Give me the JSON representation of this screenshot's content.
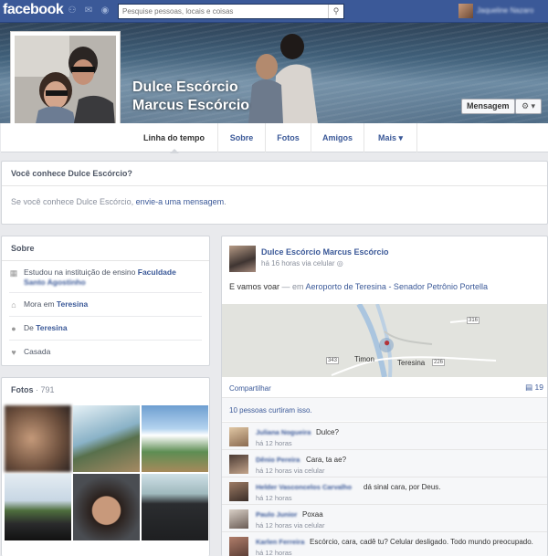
{
  "topbar": {
    "logo": "facebook",
    "search_placeholder": "Pesquise pessoas, locais e coisas",
    "user_name": "Jaqueline Nazaro"
  },
  "profile": {
    "name_line1": "Dulce Escórcio",
    "name_line2": "Marcus Escórcio",
    "message_button": "Mensagem"
  },
  "tabs": [
    {
      "label": "Linha do tempo"
    },
    {
      "label": "Sobre"
    },
    {
      "label": "Fotos"
    },
    {
      "label": "Amigos"
    },
    {
      "label": "Mais"
    }
  ],
  "know_card": {
    "title": "Você conhece Dulce Escórcio?",
    "body_prefix": "Se você conhece Dulce Escórcio, ",
    "body_link": "envie-a uma mensagem",
    "body_suffix": "."
  },
  "about": {
    "title": "Sobre",
    "education_prefix": "Estudou na instituição de ensino ",
    "education_school": "Faculdade",
    "education_school_2": "Santo Agostinho",
    "lives_prefix": "Mora em ",
    "lives_city": "Teresina",
    "from_prefix": "De ",
    "from_city": "Teresina",
    "relationship": "Casada"
  },
  "photos": {
    "title": "Fotos",
    "separator": " · ",
    "count": "791"
  },
  "post": {
    "author": "Dulce Escórcio Marcus Escórcio",
    "meta": "há 16 horas via celular",
    "text_prefix": "E vamos voar",
    "text_with": " — em ",
    "place": "Aeroporto de Teresina - Senador Petrônio Portella",
    "map_labels": {
      "timon": "Timon",
      "teresina": "Teresina",
      "road1": "316",
      "road2": "343",
      "road3": "226"
    },
    "share": "Compartilhar",
    "comment_count": "19",
    "likes": "10 pessoas curtiram isso."
  },
  "comments": [
    {
      "name": "Juliana Nogueira",
      "text": "Dulce?",
      "time": "há 12 horas"
    },
    {
      "name": "Dênio Pereira",
      "text": "Cara, ta ae?",
      "time": "há 12 horas via celular"
    },
    {
      "name": "Helder Vasconcelos Carvalho",
      "text": "dá sinal cara, por Deus.",
      "time": "há 12 horas"
    },
    {
      "name": "Paulo Junior",
      "text": "Poxaa",
      "time": "há 12 horas via celular"
    },
    {
      "name": "Karlen Ferreira",
      "text": "Escórcio, cara, cadê tu? Celular desligado. Todo mundo preocupado.",
      "time": "há 12 horas"
    }
  ],
  "colors": {
    "brand": "#3b5998",
    "background": "#e9eaed",
    "muted": "#898f9c"
  },
  "icons": [
    "friend-requests-icon",
    "messages-icon",
    "notifications-icon",
    "search-icon",
    "gear-icon",
    "education-icon",
    "home-icon",
    "location-pin-icon",
    "heart-icon",
    "globe-icon",
    "comment-icon",
    "map-pin-icon"
  ]
}
